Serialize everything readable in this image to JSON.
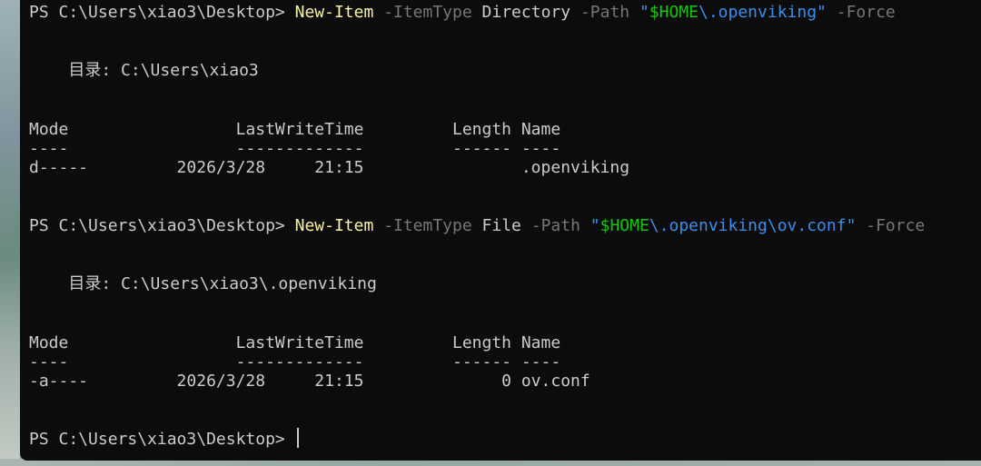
{
  "prompt": "PS C:\\Users\\xiao3\\Desktop> ",
  "cmd1": {
    "command": "New-Item",
    "itemtype_param": "-ItemType",
    "itemtype_value": "Directory",
    "path_param": "-Path",
    "quote_open": "\"",
    "path_var": "$HOME",
    "path_rest": "\\.openviking",
    "quote_close": "\"",
    "force_param": "-Force"
  },
  "dir1_line": "    目录: C:\\Users\\xiao3",
  "header_line": "Mode                 LastWriteTime         Length Name",
  "sep_line": "----                 -------------         ------ ----",
  "row1": "d-----         2026/3/28     21:15                .openviking",
  "cmd2": {
    "command": "New-Item",
    "itemtype_param": "-ItemType",
    "itemtype_value": "File",
    "path_param": "-Path",
    "quote_open": "\"",
    "path_var": "$HOME",
    "path_rest": "\\.openviking\\ov.conf",
    "quote_close": "\"",
    "force_param": "-Force"
  },
  "dir2_line": "    目录: C:\\Users\\xiao3\\.openviking",
  "row2": "-a----         2026/3/28     21:15              0 ov.conf",
  "colors": {
    "background": "#0c0c0c",
    "text": "#cccccc",
    "command": "#f9f1a5",
    "parameter": "#767676",
    "string": "#3b8eea",
    "variable": "#16c60c"
  }
}
